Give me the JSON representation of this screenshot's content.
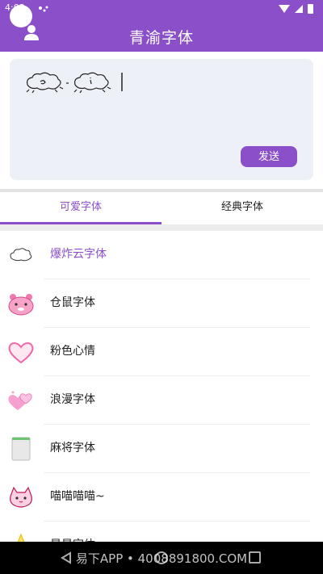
{
  "status": {
    "time": "4:03"
  },
  "appbar": {
    "title": "青渝字体",
    "user_icon": "user-icon"
  },
  "editor": {
    "sample_icon": "cloud-font-sample",
    "send_label": "发送"
  },
  "tabs": [
    {
      "label": "可爱字体",
      "active": true
    },
    {
      "label": "经典字体",
      "active": false
    }
  ],
  "fonts": [
    {
      "label": "爆炸云字体",
      "icon": "cloud-icon",
      "selected": true
    },
    {
      "label": "仓鼠字体",
      "icon": "hamster-icon",
      "selected": false
    },
    {
      "label": "粉色心情",
      "icon": "pink-heart-icon",
      "selected": false
    },
    {
      "label": "浪漫字体",
      "icon": "romantic-heart-icon",
      "selected": false
    },
    {
      "label": "麻将字体",
      "icon": "mahjong-tile-icon",
      "selected": false
    },
    {
      "label": "喵喵喵喵~",
      "icon": "cat-icon",
      "selected": false
    },
    {
      "label": "星星字体",
      "icon": "star-icon",
      "selected": false
    }
  ],
  "nav": {
    "watermark": "易下APP • 4008891800.COM"
  },
  "colors": {
    "accent": "#8b4fc9",
    "editor_bg": "#eef0f8"
  }
}
